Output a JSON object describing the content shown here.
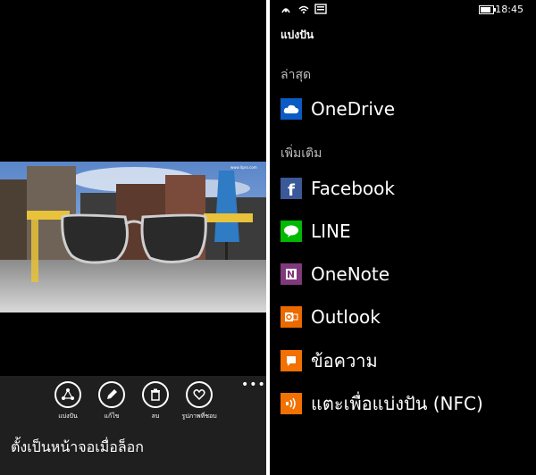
{
  "left": {
    "appbar": {
      "share_label": "แบ่งปัน",
      "edit_label": "แก้ไข",
      "delete_label": "ลบ",
      "favorite_label": "รูปภาพที่ชอบ",
      "more_label": "•••"
    },
    "lockscreen_label": "ตั้งเป็นหน้าจอเมื่อล็อก",
    "photo_watermark": "www.itpro.com"
  },
  "right": {
    "status": {
      "time": "18:45"
    },
    "title": "แบ่งปัน",
    "recent_header": "ล่าสุด",
    "more_header": "เพิ่มเติม",
    "recent_items": [
      {
        "label": "OneDrive",
        "icon": "onedrive-icon",
        "color": "#0a5cc4"
      }
    ],
    "more_items": [
      {
        "label": "Facebook",
        "icon": "facebook-icon",
        "color": "#3b5998"
      },
      {
        "label": "LINE",
        "icon": "line-icon",
        "color": "#00b900"
      },
      {
        "label": "OneNote",
        "icon": "onenote-icon",
        "color": "#80397b"
      },
      {
        "label": "Outlook",
        "icon": "outlook-icon",
        "color": "#eb6a00"
      },
      {
        "label": "ข้อความ",
        "icon": "messaging-icon",
        "color": "#f27100"
      },
      {
        "label": "แตะเพื่อแบ่งปัน (NFC)",
        "icon": "nfc-icon",
        "color": "#f27100"
      }
    ]
  }
}
